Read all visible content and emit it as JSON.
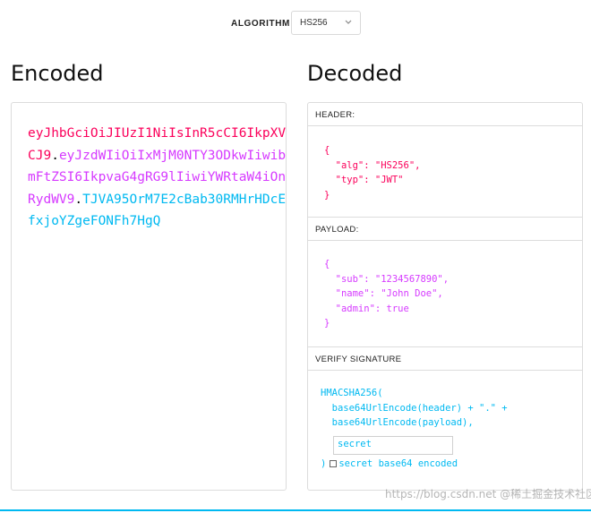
{
  "algorithm": {
    "label": "ALGORITHM",
    "selected": "HS256"
  },
  "encoded": {
    "title": "Encoded",
    "token_header": "eyJhbGciOiJIUzI1NiIsInR5cCI6IkpXVCJ9",
    "token_payload": "eyJzdWIiOiIxMjM0NTY3ODkwIiwibmFtZSI6IkpvaG4gRG9lIiwiYWRtaW4iOnRydWV9",
    "token_signature": "TJVA95OrM7E2cBab30RMHrHDcEfxjoYZgeFONFh7HgQ",
    "dot": "."
  },
  "decoded": {
    "title": "Decoded",
    "header_title": "HEADER:",
    "payload_title": "PAYLOAD:",
    "verify_title": "VERIFY SIGNATURE",
    "header_json": "{\n  \"alg\": \"HS256\",\n  \"typ\": \"JWT\"\n}",
    "payload_json": "{\n  \"sub\": \"1234567890\",\n  \"name\": \"John Doe\",\n  \"admin\": true\n}",
    "verify_code": "HMACSHA256(\n  base64UrlEncode(header) + \".\" +\n  base64UrlEncode(payload),",
    "secret_value": "secret",
    "close_paren": ")",
    "checkbox_label": "secret base64 encoded"
  },
  "watermark": "https://blog.csdn.net @稀土掘金技术社区",
  "colors": {
    "header": "#fb015b",
    "payload": "#d63aff",
    "signature": "#00b9f1"
  }
}
